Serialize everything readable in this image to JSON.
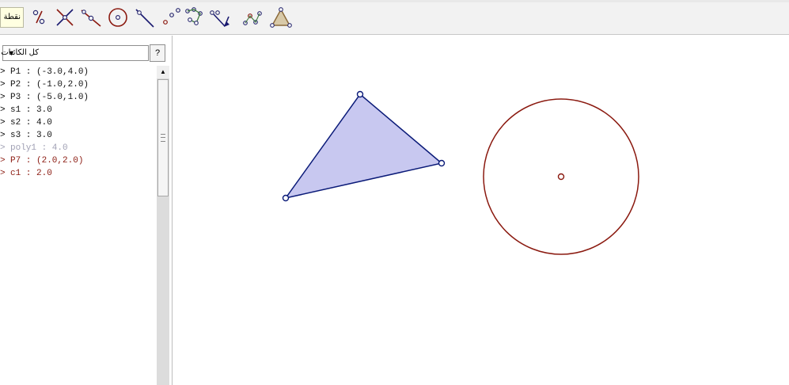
{
  "toolbar": {
    "tooltip": "نقطة",
    "tools": [
      {
        "name": "point-tool-icon"
      },
      {
        "name": "segment-length-tool-icon"
      },
      {
        "name": "intersect-tool-icon"
      },
      {
        "name": "line-point-tool-icon"
      },
      {
        "name": "circle-tool-icon"
      },
      {
        "name": "line-tool-icon"
      },
      {
        "name": "polygon-points-tool-icon"
      },
      {
        "name": "locus-tool-icon"
      },
      {
        "name": "vector-tool-icon"
      },
      {
        "name": "polyline-tool-icon"
      },
      {
        "name": "triangle-tool-icon"
      }
    ]
  },
  "left_panel": {
    "filter_label": "كل الكائنات",
    "help_label": "?",
    "objects": [
      {
        "text": "P1 : (-3.0,4.0)",
        "style": "black"
      },
      {
        "text": "P2 : (-1.0,2.0)",
        "style": "black"
      },
      {
        "text": "P3 : (-5.0,1.0)",
        "style": "black"
      },
      {
        "text": "s1 : 3.0",
        "style": "black"
      },
      {
        "text": "s2 : 4.0",
        "style": "black"
      },
      {
        "text": "s3 : 3.0",
        "style": "black"
      },
      {
        "text": "poly1 : 4.0",
        "style": "gray"
      },
      {
        "text": "P7 : (2.0,2.0)",
        "style": "red"
      },
      {
        "text": "c1 : 2.0",
        "style": "red"
      }
    ]
  },
  "colors": {
    "polygon_fill": "#c8c8f0",
    "polygon_stroke": "#0a1a78",
    "circle_stroke": "#8b1a10",
    "point_stroke": "#0a1a78"
  }
}
